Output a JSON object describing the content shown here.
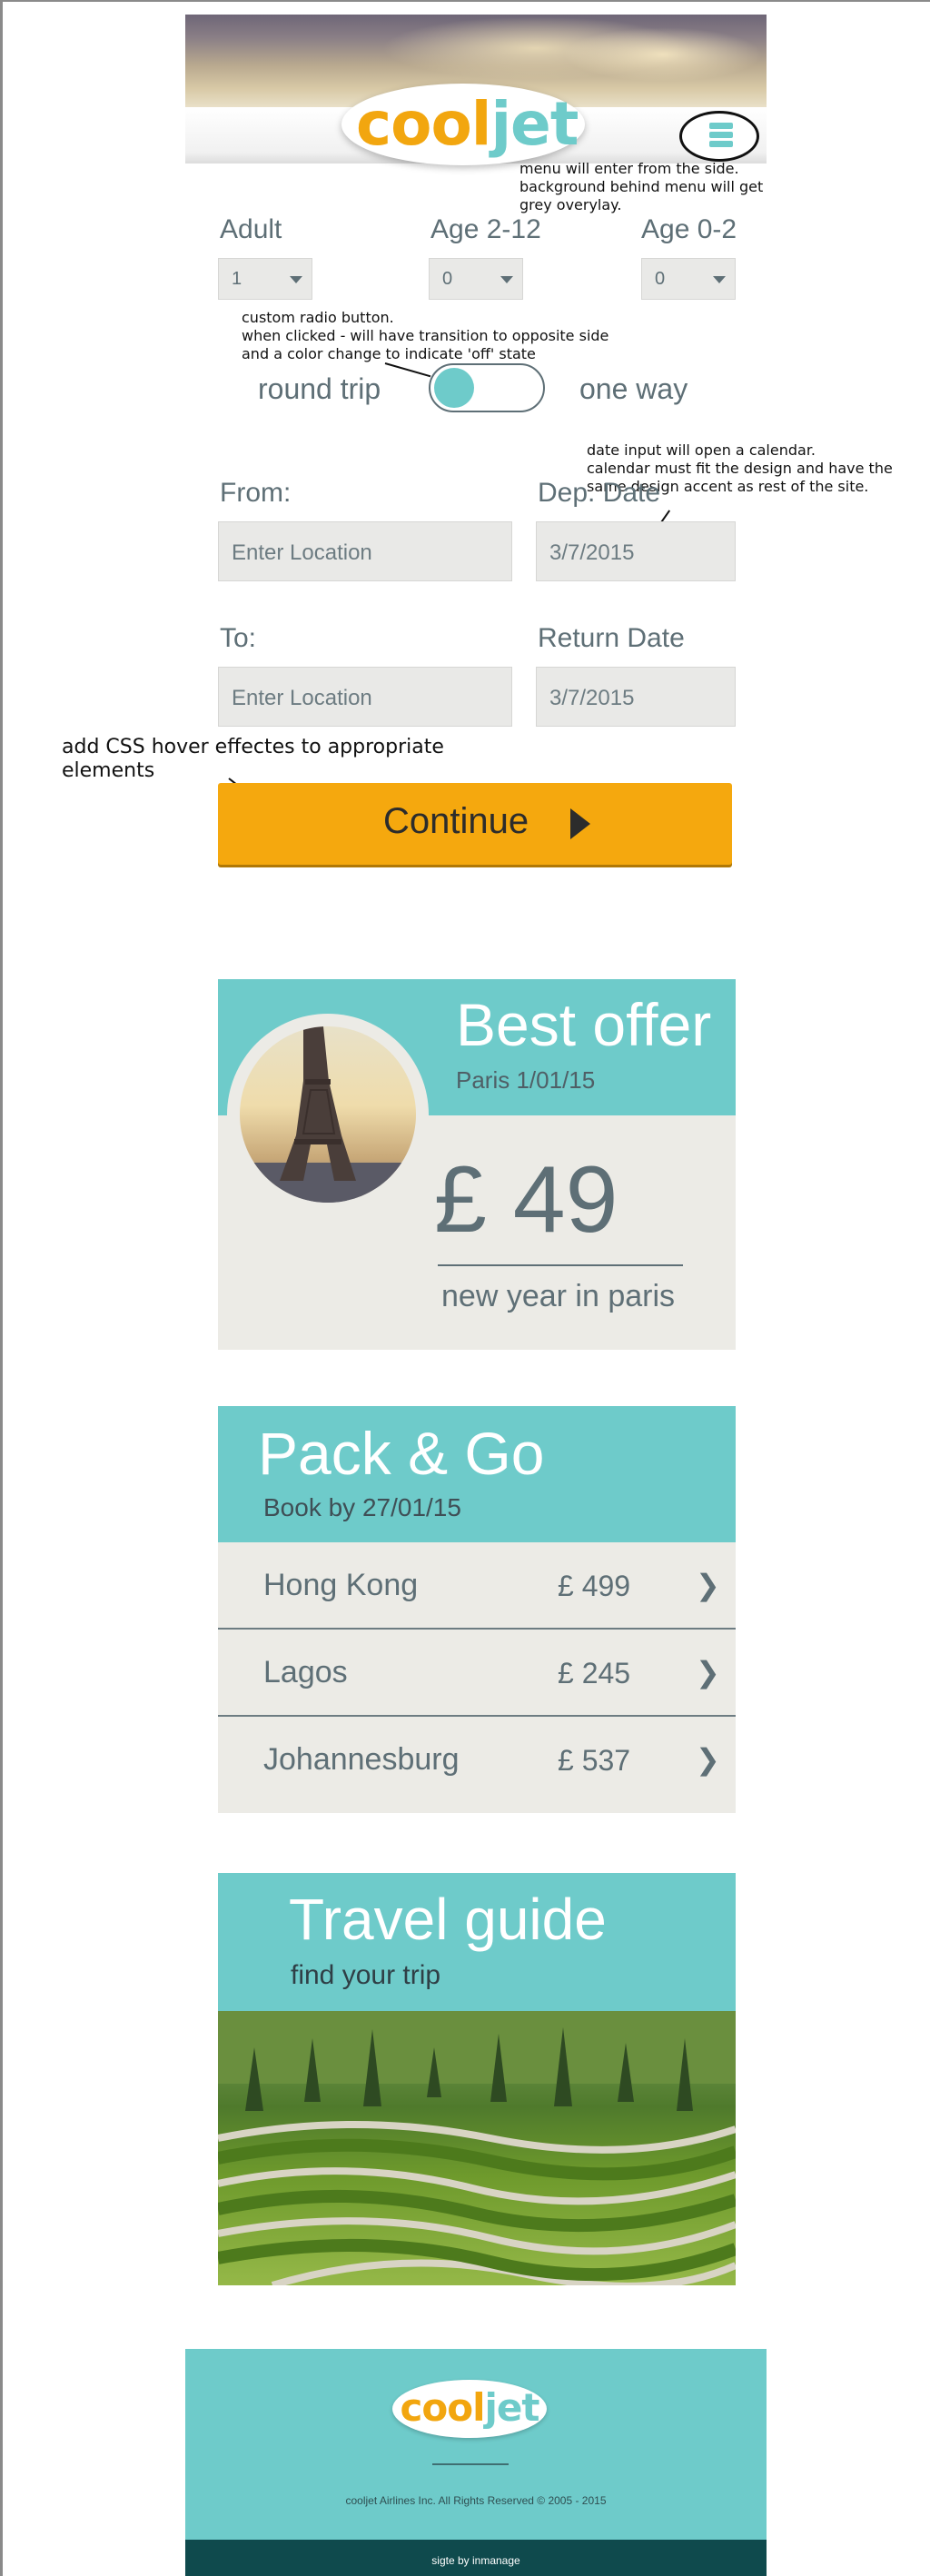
{
  "header": {
    "logo_part1": "cool",
    "logo_part2": "jet",
    "menu_icon": "hamburger-menu-icon"
  },
  "notes": {
    "menu": "menu will enter from the side.\nbackground behind menu will get\ngrey overylay.",
    "radio": "custom radio button.\nwhen clicked - will have transition to opposite side\nand a color change to indicate 'off' state",
    "date": "date input will open a calendar.\ncalendar must fit the design and have the\n same design accent as rest of the site.",
    "hover": "add CSS hover effectes to appropriate\nelements"
  },
  "passengers": [
    {
      "label": "Adult",
      "value": "1"
    },
    {
      "label": "Age 2-12",
      "value": "0"
    },
    {
      "label": "Age 0-2",
      "value": "0"
    }
  ],
  "trip": {
    "left_label": "round trip",
    "right_label": "one way"
  },
  "form": {
    "from_label": "From:",
    "from_placeholder": "Enter Location",
    "dep_label": "Dep. Date",
    "dep_value": "3/7/2015",
    "to_label": "To:",
    "to_placeholder": "Enter Location",
    "return_label": "Return Date",
    "return_value": "3/7/2015",
    "continue_label": "Continue"
  },
  "best_offer": {
    "title": "Best offer",
    "subtitle": "Paris 1/01/15",
    "price": "£ 49",
    "description": "new year in paris"
  },
  "pack_go": {
    "title": "Pack & Go",
    "subtitle": "Book by 27/01/15",
    "items": [
      {
        "city": "Hong Kong",
        "price": "£ 499"
      },
      {
        "city": "Lagos",
        "price": "£ 245"
      },
      {
        "city": "Johannesburg",
        "price": "£ 537"
      }
    ]
  },
  "travel_guide": {
    "title": "Travel guide",
    "subtitle": "find your trip"
  },
  "footer": {
    "logo_part1": "cool",
    "logo_part2": "jet",
    "copyright": "cooljet Airlines Inc. All Rights Reserved © 2005 - 2015",
    "credit": "sigte by inmanage"
  },
  "colors": {
    "teal": "#6ecbca",
    "orange": "#f5a80e",
    "slate": "#5e6f76",
    "panel": "#ecebe6",
    "footer_dark": "#0f4a4d"
  }
}
